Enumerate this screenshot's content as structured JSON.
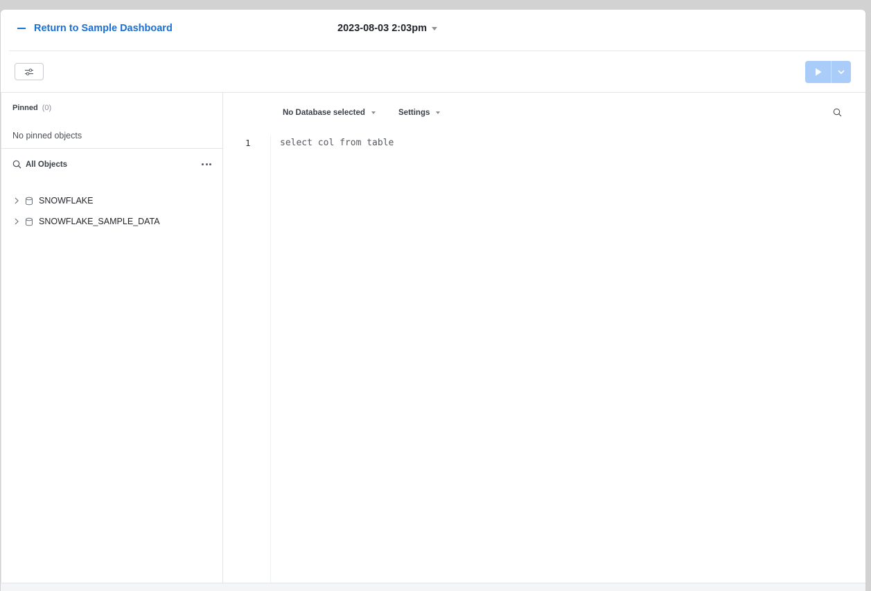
{
  "header": {
    "return_label": "Return to Sample Dashboard",
    "worksheet_title": "2023-08-03 2:03pm"
  },
  "sidebar": {
    "pinned_title": "Pinned",
    "pinned_count": "(0)",
    "pinned_empty": "No pinned objects",
    "objects_title": "All Objects",
    "databases": [
      {
        "label": "SNOWFLAKE"
      },
      {
        "label": "SNOWFLAKE_SAMPLE_DATA"
      }
    ]
  },
  "editor": {
    "database_select": "No Database selected",
    "settings_label": "Settings",
    "lines": [
      {
        "number": "1",
        "code": "select col from table"
      }
    ]
  },
  "colors": {
    "accent": "#1a6fd4",
    "run_button": "#a9cdf8"
  },
  "icons": {
    "return": "minus-icon",
    "filter": "sliders-icon",
    "run": "play-icon",
    "run_menu": "chevron-down-icon",
    "objects_search": "search-icon",
    "more": "more-horizontal-icon",
    "expand": "chevron-right-icon",
    "database": "database-icon",
    "editor_search": "search-icon"
  }
}
